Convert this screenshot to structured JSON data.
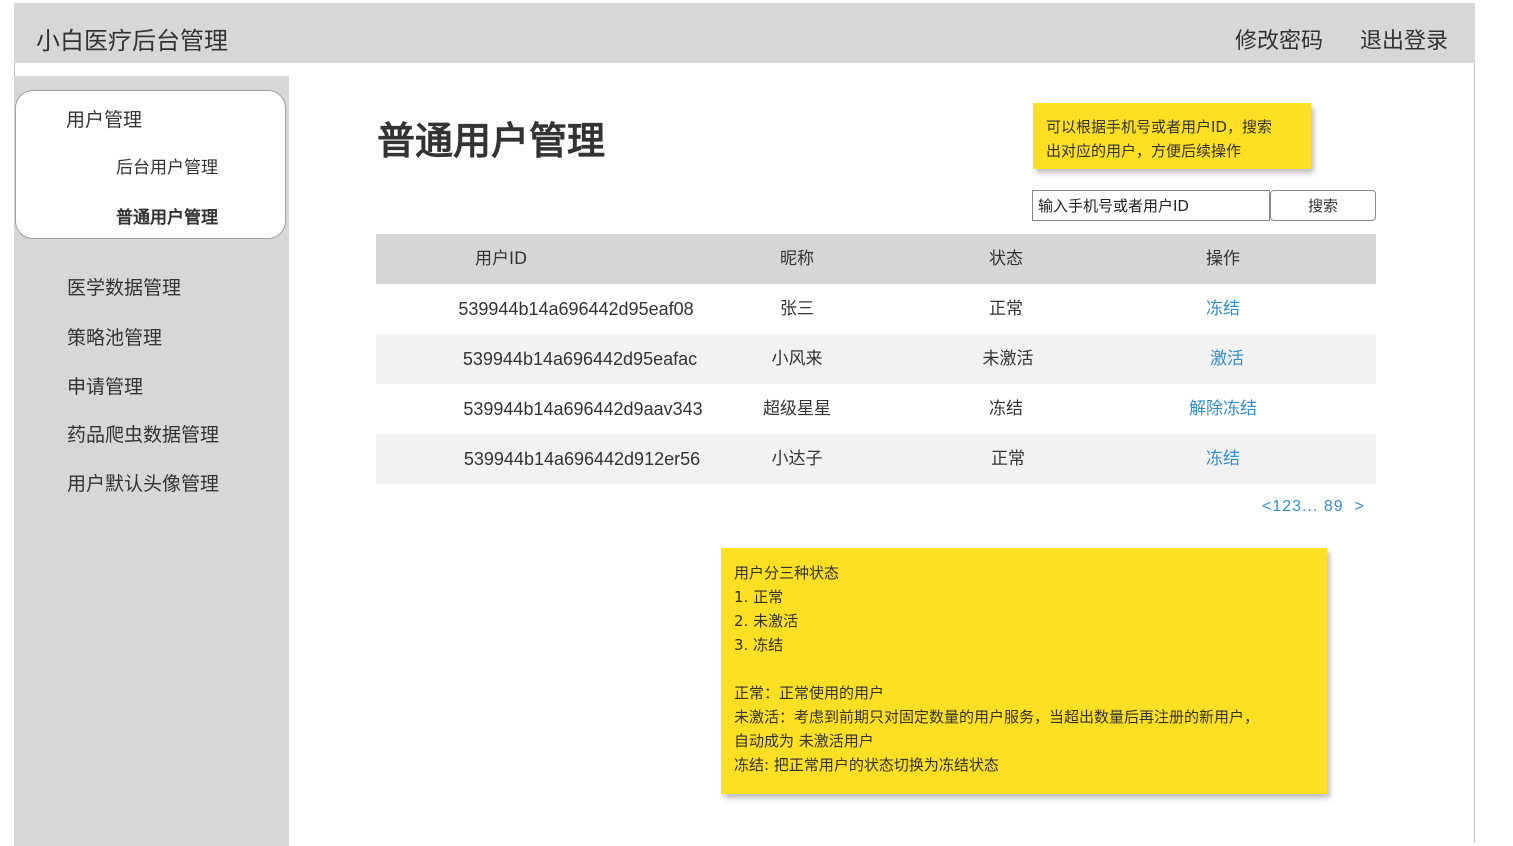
{
  "header": {
    "title": "小白医疗后台管理",
    "change_password": "修改密码",
    "logout": "退出登录"
  },
  "sidebar": {
    "group_title": "用户管理",
    "sub_items": [
      "后台用户管理",
      "普通用户管理"
    ],
    "items": [
      "医学数据管理",
      "策略池管理",
      "申请管理",
      "药品爬虫数据管理",
      "用户默认头像管理"
    ]
  },
  "main": {
    "title": "普通用户管理",
    "search": {
      "value": "输入手机号或者用户ID",
      "button": "搜索"
    },
    "table": {
      "columns": [
        "用户ID",
        "昵称",
        "状态",
        "操作"
      ],
      "rows": [
        {
          "id": "539944b14a696442d95eaf08",
          "nickname": "张三",
          "status": "正常",
          "action": "冻结"
        },
        {
          "id": "539944b14a696442d95eafac",
          "nickname": "小风来",
          "status": "未激活",
          "action": "激活"
        },
        {
          "id": "539944b14a696442d9aav343",
          "nickname": "超级星星",
          "status": "冻结",
          "action": "解除冻结"
        },
        {
          "id": "539944b14a696442d912er56",
          "nickname": "小达子",
          "status": "正常",
          "action": "冻结"
        }
      ]
    },
    "pagination": "<123... 89  >"
  },
  "notes": {
    "search_note": [
      "可以根据手机号或者用户ID，搜索",
      "出对应的用户，方便后续操作"
    ],
    "status_note": [
      "用户分三种状态",
      "1. 正常",
      "2. 未激活",
      "3. 冻结",
      "",
      "正常：正常使用的用户",
      "未激活：考虑到前期只对固定数量的用户服务，当超出数量后再注册的新用户，",
      "自动成为 未激活用户",
      "冻结: 把正常用户的状态切换为冻结状态"
    ]
  },
  "colors": {
    "header_bg": "#d7d7d7",
    "note_bg": "#fddf24",
    "link": "#2e8fd0"
  }
}
